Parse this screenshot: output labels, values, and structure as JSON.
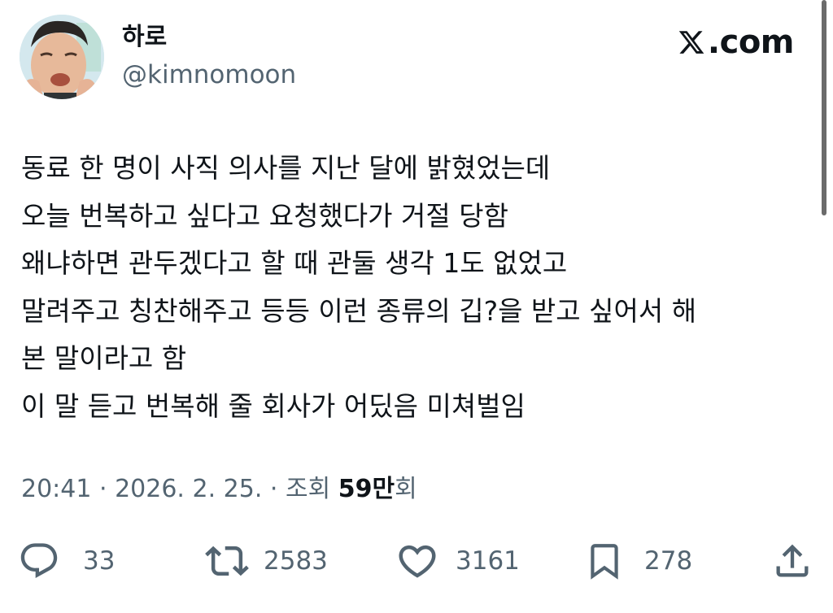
{
  "author": {
    "display_name": "하로",
    "handle": "@kimnomoon",
    "avatar_icon": "profile-photo"
  },
  "brand": {
    "label": ".com",
    "icon": "x-logo-icon"
  },
  "tweet": {
    "lines": [
      "동료 한 명이 사직 의사를 지난 달에 밝혔었는데",
      "오늘 번복하고 싶다고 요청했다가 거절 당함",
      "왜냐하면 관두겠다고 할 때 관둘 생각 1도 없었고",
      "말려주고 칭찬해주고 등등 이런 종류의 깁?을 받고 싶어서 해",
      "본 말이라고 함",
      "이 말 듣고 번복해 줄 회사가 어딨음 미쳐벌임"
    ]
  },
  "meta": {
    "time": "20:41",
    "separator": " · ",
    "date": "2026. 2. 25.",
    "views_label": "조회",
    "views_count": "59만",
    "views_suffix": "회"
  },
  "actions": {
    "replies": "33",
    "reposts": "2583",
    "likes": "3161",
    "bookmarks": "278"
  },
  "colors": {
    "text_primary": "#0f1419",
    "text_secondary": "#536471",
    "background": "#ffffff"
  }
}
